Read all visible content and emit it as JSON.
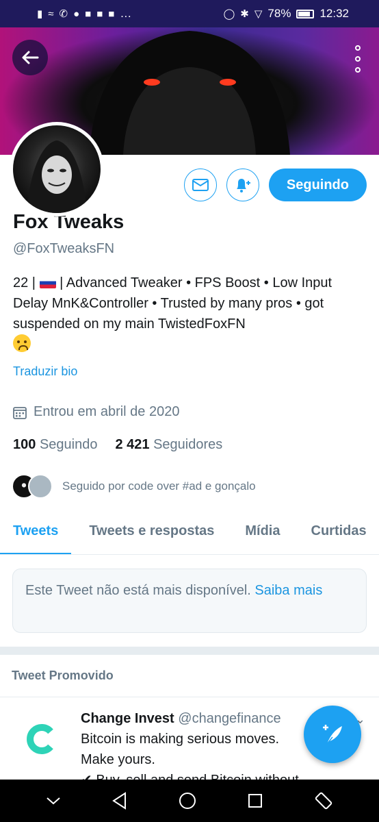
{
  "status_bar": {
    "battery": "78%",
    "time": "12:32",
    "overflow": "…"
  },
  "profile": {
    "name": "Fox Tweaks",
    "handle": "@FoxTweaksFN",
    "bio_prefix": "22 |",
    "bio_rest": "| Advanced Tweaker • FPS Boost • Low Input Delay MnK&Controller • Trusted by many pros • got suspended on my main TwistedFoxFN",
    "translate_label": "Traduzir bio",
    "joined": "Entrou em abril de 2020",
    "following_count": "100",
    "following_label": "Seguindo",
    "followers_count": "2 421",
    "followers_label": "Seguidores",
    "followed_by": "Seguido por code over #ad e gonçalo"
  },
  "actions": {
    "follow_label": "Seguindo"
  },
  "tabs": [
    {
      "label": "Tweets",
      "active": true
    },
    {
      "label": "Tweets e respostas",
      "active": false
    },
    {
      "label": "Mídia",
      "active": false
    },
    {
      "label": "Curtidas",
      "active": false
    }
  ],
  "unavailable_tweet": {
    "text": "Este Tweet não está mais disponível.",
    "link": "Saiba mais"
  },
  "promoted": {
    "label": "Tweet Promovido",
    "author": "Change Invest",
    "handle": "@changefinance",
    "line1": "Bitcoin is making serious moves.",
    "line2": "Make yours.",
    "line3": "✔ Buy, sell and send Bitcoin without"
  },
  "colors": {
    "accent": "#1da1f2",
    "link": "#1b95e0",
    "muted": "#657786",
    "status_bar": "#1f1a5c"
  }
}
